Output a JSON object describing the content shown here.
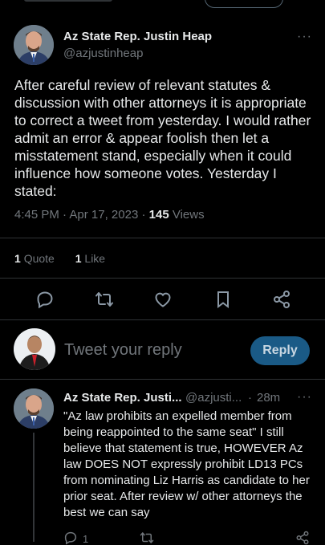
{
  "tweet": {
    "author_name": "Az State Rep. Justin Heap",
    "author_handle": "@azjustinheap",
    "text": "After careful review of relevant statutes & discussion with other attorneys it is appropriate to correct a tweet from yesterday. I would rather admit an error & appear foolish then let a misstatement stand, especially when it could influence how someone votes. Yesterday I stated:",
    "time": "4:45 PM",
    "date": "Apr 17, 2023",
    "views_count": "145",
    "views_label": "Views",
    "quote_count": "1",
    "quote_label": "Quote",
    "like_count": "1",
    "like_label": "Like",
    "more": "···"
  },
  "actions": {
    "icons": [
      "reply-icon",
      "retweet-icon",
      "like-icon",
      "bookmark-icon",
      "share-icon"
    ]
  },
  "composer": {
    "placeholder": "Tweet your reply",
    "reply_button": "Reply"
  },
  "reply": {
    "author_name": "Az State Rep. Justi...",
    "author_handle": "@azjusti...",
    "separator": "·",
    "age": "28m",
    "more": "···",
    "text": "\"Az law prohibits an expelled member from being reappointed to the same seat\" I still believe that statement is true, HOWEVER Az law DOES NOT expressly prohibit LD13 PCs from nominating Liz Harris as candidate to her prior seat. After review w/ other attorneys the best we can say",
    "reply_count": "1"
  },
  "colors": {
    "background": "#000000",
    "text": "#e7e9ea",
    "muted": "#71767b",
    "divider": "#2f3336",
    "reply_button": "#1a5a86"
  }
}
